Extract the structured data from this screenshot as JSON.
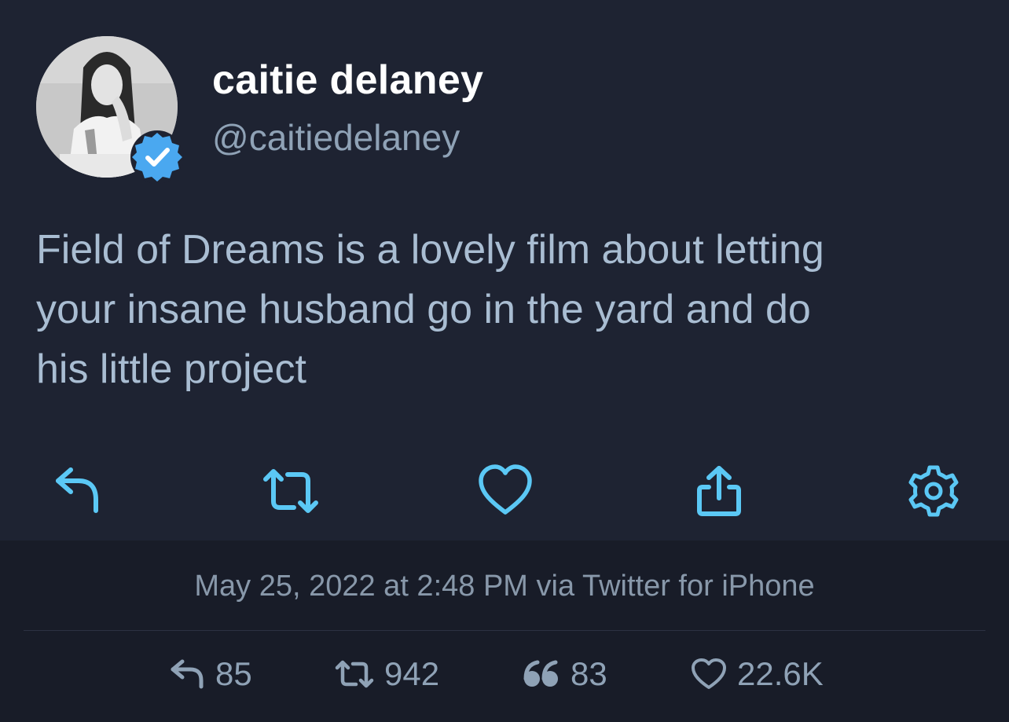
{
  "user": {
    "display_name": "caitie delaney",
    "handle": "@caitiedelaney",
    "verified": true
  },
  "tweet": {
    "text_lines": [
      "Field of Dreams is a lovely film about letting",
      "your insane husband go in the yard and do",
      "his little project"
    ],
    "timestamp": "May 25, 2022 at 2:48 PM via Twitter for iPhone"
  },
  "actions": [
    {
      "name": "reply",
      "icon": "reply-icon"
    },
    {
      "name": "retweet",
      "icon": "retweet-icon"
    },
    {
      "name": "like",
      "icon": "heart-icon"
    },
    {
      "name": "share",
      "icon": "share-icon"
    },
    {
      "name": "settings",
      "icon": "gear-icon"
    }
  ],
  "stats": {
    "replies": "85",
    "retweets": "942",
    "quotes": "83",
    "likes": "22.6K"
  },
  "colors": {
    "background": "#1e2332",
    "meta_background": "#181c28",
    "accent": "#5bc8f5",
    "verified": "#4aa8f0",
    "text": "#a9bdd2",
    "muted": "#8898aa"
  }
}
